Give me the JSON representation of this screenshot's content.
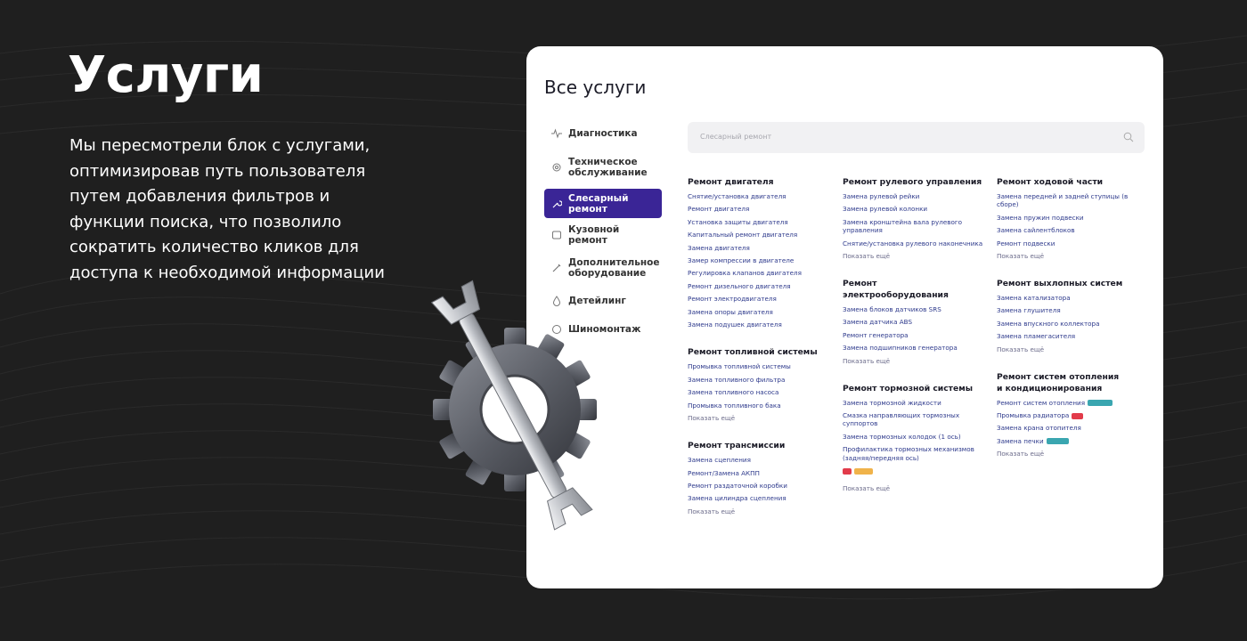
{
  "headline": "Услуги",
  "description": "Мы пересмотрели блок с услугами, оптимизировав путь пользователя путем добавления фильтров и функции поиска, что позволило сократить количество кликов для доступа к необходимой информации",
  "card": {
    "title": "Все услуги",
    "search_placeholder": "Слесарный ремонт",
    "sidebar": [
      {
        "label": "Диагностика",
        "icon": "pulse-icon",
        "active": false
      },
      {
        "label": "Техническое обслуживание",
        "icon": "gear-icon",
        "active": false
      },
      {
        "label": "Слесарный ремонт",
        "icon": "wrench-icon",
        "active": true
      },
      {
        "label": "Кузовной ремонт",
        "icon": "car-body-icon",
        "active": false
      },
      {
        "label": "Дополнительное оборудование",
        "icon": "tool-icon",
        "active": false
      },
      {
        "label": "Детейлинг",
        "icon": "drop-icon",
        "active": false
      },
      {
        "label": "Шиномонтаж",
        "icon": "tire-icon",
        "active": false
      }
    ],
    "col1": {
      "sections": [
        {
          "title": "Ремонт двигателя",
          "items": [
            "Снятие/установка двигателя",
            "Ремонт двигателя",
            "Установка защиты двигателя",
            "Капитальный ремонт двигателя",
            "Замена двигателя",
            "Замер компрессии в двигателе",
            "Регулировка клапанов двигателя",
            "Ремонт дизельного двигателя",
            "Ремонт электродвигателя",
            "Замена опоры двигателя",
            "Замена подушек двигателя"
          ],
          "more": ""
        },
        {
          "title": "Ремонт топливной системы",
          "items": [
            "Промывка топливной системы",
            "Замена топливного фильтра",
            "Замена топливного насоса",
            "Промывка топливного бака"
          ],
          "more": "Показать ещё"
        },
        {
          "title": "Ремонт трансмиссии",
          "items": [
            "Замена сцепления",
            "Ремонт/Замена АКПП",
            "Ремонт раздаточной коробки",
            "Замена цилиндра сцепления"
          ],
          "more": "Показать ещё"
        }
      ]
    },
    "col2": {
      "sections": [
        {
          "title": "Ремонт рулевого управления",
          "items": [
            "Замена рулевой рейки",
            "Замена рулевой колонки",
            "Замена кронштейна вала рулевого управления",
            "Снятие/установка рулевого наконечника"
          ],
          "more": "Показать ещё"
        },
        {
          "title": "Ремонт электрооборудования",
          "items": [
            "Замена блоков датчиков SRS",
            "Замена датчика ABS",
            "Ремонт генератора",
            "Замена подшипников генератора"
          ],
          "more": "Показать ещё"
        },
        {
          "title": "Ремонт тормозной системы",
          "items": [
            "Замена тормозной жидкости",
            "Смазка направляющих тормозных суппортов",
            "Замена тормозных колодок (1 ось)",
            "Профилактика тормозных механизмов (задняя/передняя ось)"
          ],
          "more": "Показать ещё"
        }
      ]
    },
    "col3": {
      "sections": [
        {
          "title": "Ремонт ходовой части",
          "items": [
            "Замена передней и задней ступицы (в сборе)",
            "Замена пружин подвески",
            "Замена сайлентблоков",
            "Ремонт подвески"
          ],
          "more": "Показать ещё"
        },
        {
          "title": "Ремонт выхлопных систем",
          "items": [
            "Замена катализатора",
            "Замена глушителя",
            "Замена впускного коллектора",
            "Замена пламегасителя"
          ],
          "more": "Показать ещё"
        },
        {
          "title": "Ремонт систем отопления и кондиционирования",
          "items": [
            "Ремонт систем отопления",
            "Промывка радиатора",
            "Замена крана отопителя",
            "Замена печки"
          ],
          "more": "Показать ещё"
        }
      ]
    }
  },
  "colors": {
    "accent": "#3a2596",
    "background": "#1f1f1f",
    "link": "#2e3a8c"
  }
}
